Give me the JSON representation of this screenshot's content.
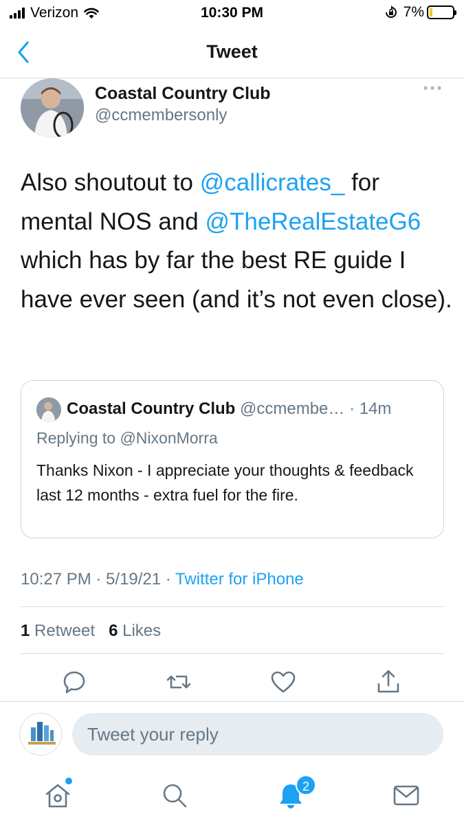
{
  "status_bar": {
    "carrier": "Verizon",
    "time": "10:30 PM",
    "battery_percent": "7%",
    "battery_level": 0.07
  },
  "nav": {
    "title": "Tweet"
  },
  "tweet": {
    "author_name": "Coastal Country Club",
    "author_handle": "@ccmembersonly",
    "text_parts": [
      "Also shoutout to ",
      "@callicrates_",
      " for mental NOS and ",
      "@TheRealEstateG6",
      " which has by far the best RE guide I have ever seen (and it’s not even close)."
    ],
    "timestamp": "10:27 PM · 5/19/21 · ",
    "source": "Twitter for iPhone",
    "retweets_count": "1",
    "retweets_label": "Retweet",
    "likes_count": "6",
    "likes_label": "Likes"
  },
  "quote": {
    "author_name": "Coastal Country Club",
    "meta": " @ccmembe… · 14m",
    "replying_to": "Replying to @NixonMorra",
    "text": "Thanks Nixon - I appreciate your thoughts & feedback last 12 months - extra fuel for the fire."
  },
  "reply_box": {
    "placeholder": "Tweet your reply"
  },
  "tab_bar": {
    "notifications_badge": "2"
  },
  "colors": {
    "accent": "#1da1f2",
    "secondary_text": "#657786",
    "primary_text": "#14171a",
    "divider": "#d8dde1",
    "battery_low": "#f5c518"
  },
  "icons": {
    "back": "chevron-left-icon",
    "more": "more-horizontal-icon",
    "reply": "comment-icon",
    "retweet": "retweet-icon",
    "like": "heart-icon",
    "share": "share-icon",
    "home": "home-icon",
    "search": "search-icon",
    "notifications": "bell-icon",
    "messages": "mail-icon"
  }
}
